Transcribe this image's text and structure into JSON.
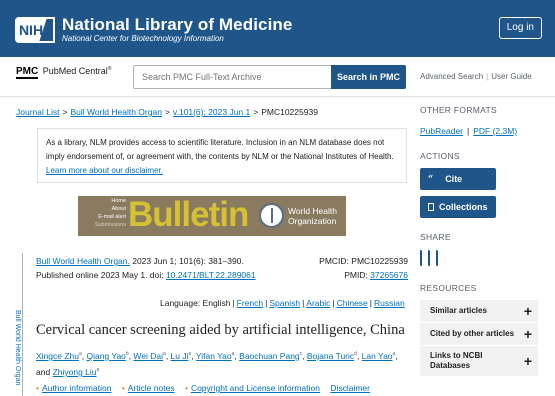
{
  "header": {
    "logo": "NIH",
    "title": "National Library of Medicine",
    "subtitle": "National Center for Biotechnology Information",
    "login": "Log in"
  },
  "pmc": {
    "logo_mark": "PMC",
    "logo_text": "PubMed Central",
    "logo_reg": "®",
    "search_placeholder": "Search PMC Full-Text Archive",
    "search_button": "Search in PMC",
    "advanced_search": "Advanced Search",
    "user_guide": "User Guide"
  },
  "breadcrumb": {
    "items": [
      "Journal List",
      "Bull World Health Organ",
      "v.101(6); 2023 Jun 1",
      "PMC10225939"
    ]
  },
  "disclaimer": {
    "text": "As a library, NLM provides access to scientific literature. Inclusion in an NLM database does not imply endorsement of, or agreement with, the contents by NLM or the National Institutes of Health.",
    "link": "Learn more about our disclaimer."
  },
  "banner": {
    "menu": [
      "Home",
      "About",
      "E-mail alert",
      "Submissions"
    ],
    "title": "Bulletin",
    "org_line1": "World Health",
    "org_line2": "Organization"
  },
  "citation": {
    "journal_link": "Bull World Health Organ.",
    "journal_detail": " 2023 Jun 1; 101(6): 381–390.",
    "published": "Published online 2023 May 1. doi: ",
    "doi": "10.2471/BLT.22.289061",
    "pmcid_label": "PMCID: ",
    "pmcid": "PMC10225939",
    "pmid_label": "PMID: ",
    "pmid": "37265676",
    "vertical_journal": "Bull World Health Organ"
  },
  "language": {
    "label": "Language: ",
    "current": "English",
    "others": [
      "French",
      "Spanish",
      "Arabic",
      "Chinese",
      "Russian"
    ]
  },
  "article": {
    "title": "Cervical cancer screening aided by artificial intelligence, China",
    "authors": [
      {
        "name": "Xingce Zhu",
        "sup": "a"
      },
      {
        "name": "Qiang Yao",
        "sup": "b"
      },
      {
        "name": "Wei Dai",
        "sup": "a"
      },
      {
        "name": "Lu Ji",
        "sup": "a"
      },
      {
        "name": "Yifan Yao",
        "sup": "a"
      },
      {
        "name": "Baochuan Pang",
        "sup": "c"
      },
      {
        "name": "Bojana Turic",
        "sup": "d"
      },
      {
        "name": "Lan Yao",
        "sup": "a"
      },
      {
        "name": "Zhiyong Liu",
        "sup": "a"
      }
    ],
    "and_word": "and",
    "links": [
      "Author information",
      "Article notes",
      "Copyright and License information",
      "Disclaimer"
    ]
  },
  "sidebar": {
    "other_formats": "OTHER FORMATS",
    "pubreader": "PubReader",
    "pdf": "PDF (2.3M)",
    "actions": "ACTIONS",
    "cite": "Cite",
    "cite_glyph": "“",
    "collections": "Collections",
    "share": "SHARE",
    "resources": "RESOURCES",
    "accordions": [
      "Similar articles",
      "Cited by other articles",
      "Links to NCBI Databases"
    ],
    "plus": "+"
  },
  "colors": {
    "header_bg": "#20558a",
    "link": "#0071bc",
    "banner_gold": "#d4c234"
  }
}
